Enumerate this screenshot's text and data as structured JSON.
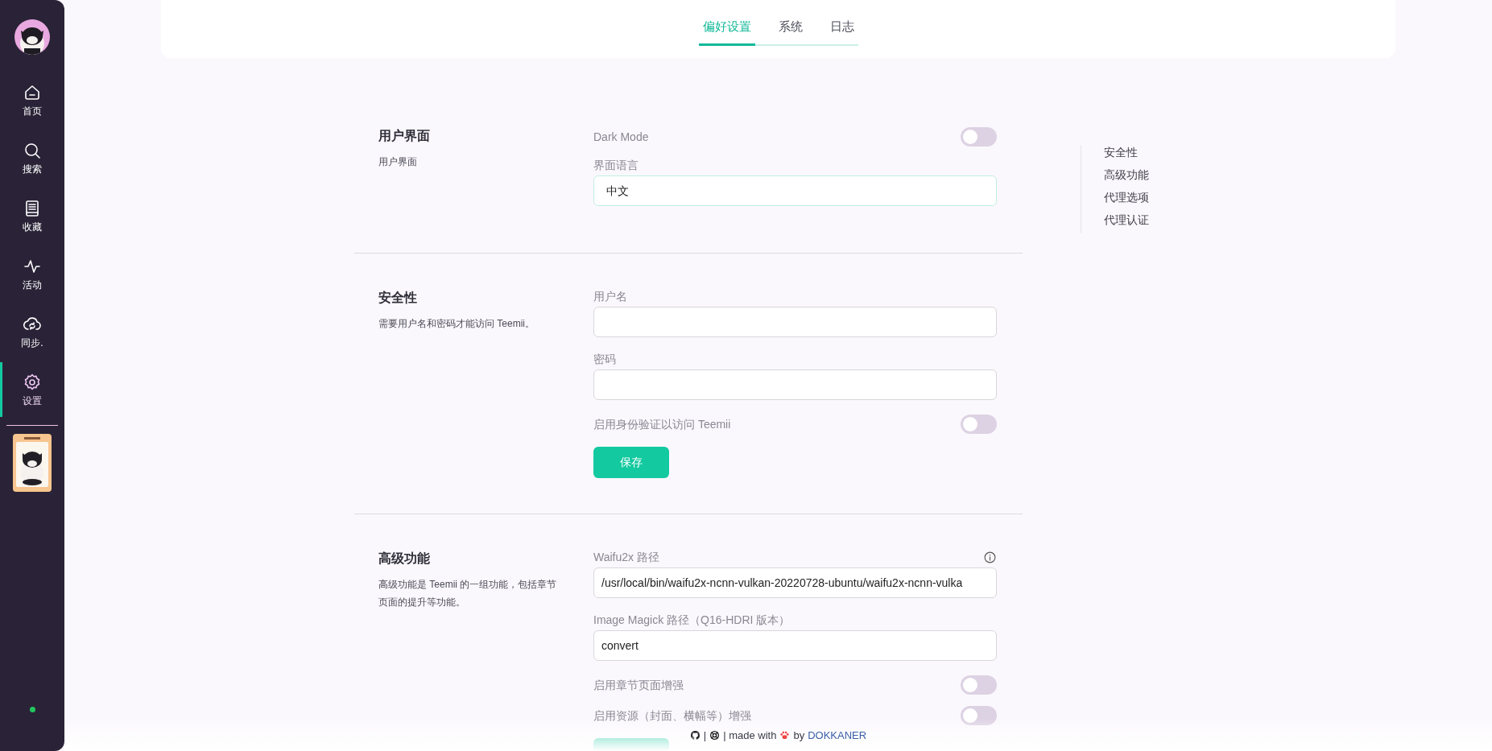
{
  "sidebar": {
    "items": [
      {
        "label": "首页",
        "selected": false
      },
      {
        "label": "搜索",
        "selected": false
      },
      {
        "label": "收藏",
        "selected": false
      },
      {
        "label": "活动",
        "selected": false
      },
      {
        "label": "同步.",
        "selected": false
      },
      {
        "label": "设置",
        "selected": true
      }
    ],
    "online": true
  },
  "tabs": [
    {
      "label": "偏好设置",
      "selected": true
    },
    {
      "label": "系统",
      "selected": false
    },
    {
      "label": "日志",
      "selected": false
    }
  ],
  "sections": [
    {
      "title": "用户界面",
      "description": "用户界面",
      "fields": [
        {
          "kind": "toggle",
          "label": "Dark Mode",
          "on": false
        },
        {
          "kind": "input",
          "label": "界面语言",
          "value": "中文",
          "focused": true
        }
      ]
    },
    {
      "title": "安全性",
      "description": "需要用户名和密码才能访问 Teemii。",
      "fields": [
        {
          "kind": "input",
          "label": "用户名"
        },
        {
          "kind": "input",
          "label": "密码"
        },
        {
          "kind": "toggle",
          "label": "启用身份验证以访问 Teemii",
          "on": false
        },
        {
          "kind": "button",
          "label": "保存"
        }
      ]
    },
    {
      "title": "高级功能",
      "description": "高级功能是 Teemii 的一组功能，包括章节页面的提升等功能。",
      "fields": [
        {
          "kind": "input",
          "label": "Waifu2x 路径",
          "value": "/usr/local/bin/waifu2x-ncnn-vulkan-20220728-ubuntu/waifu2x-ncnn-vulka",
          "info": true
        },
        {
          "kind": "input",
          "label": "Image Magick 路径（Q16-HDRI 版本）",
          "value": "convert"
        },
        {
          "kind": "toggle",
          "label": "启用章节页面增强",
          "on": false
        },
        {
          "kind": "toggle",
          "label": "启用资源（封面、横幅等）增强",
          "on": false
        },
        {
          "kind": "button"
        }
      ]
    }
  ],
  "toc": [
    "安全性",
    "高级功能",
    "代理选项",
    "代理认证"
  ],
  "footer": {
    "separator": "|",
    "made_with": "| made with",
    "by": "by",
    "link": "DOKKANER"
  }
}
